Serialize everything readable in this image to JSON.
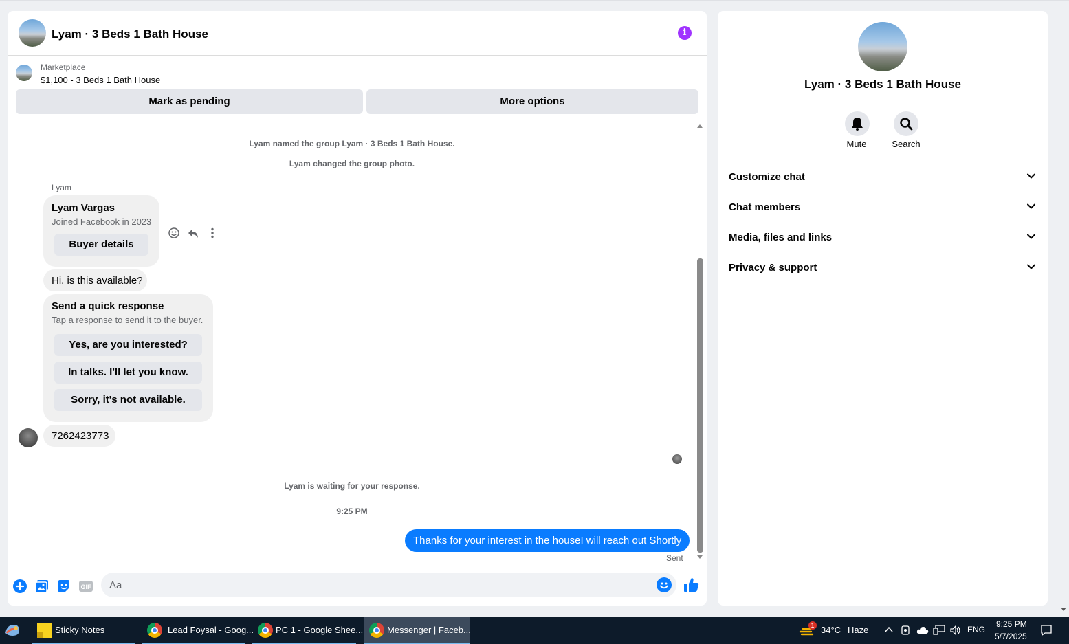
{
  "chat": {
    "title": "Lyam · 3 Beds 1 Bath House",
    "marketplace": {
      "label": "Marketplace",
      "listing": "$1,100 - 3 Beds 1 Bath House"
    },
    "actions": {
      "mark_pending": "Mark as pending",
      "more_options": "More options"
    },
    "system_messages": [
      "Lyam named the group Lyam · 3 Beds 1 Bath House.",
      "Lyam changed the group photo."
    ],
    "sender_name": "Lyam",
    "profile_card": {
      "name": "Lyam Vargas",
      "joined": "Joined Facebook in 2023",
      "button": "Buyer details"
    },
    "message_availability": "Hi, is this available?",
    "quick_response": {
      "title": "Send a quick response",
      "subtitle": "Tap a response to send it to the buyer.",
      "options": [
        "Yes, are you interested?",
        "In talks. I'll let you know.",
        "Sorry, it's not available."
      ]
    },
    "message_phone": "7262423773",
    "waiting_notice": "Lyam is waiting for your response.",
    "timestamp": "9:25 PM",
    "outgoing_message": "Thanks for your interest in the houseI will reach out Shortly",
    "sent_status": "Sent",
    "composer": {
      "placeholder": "Aa"
    }
  },
  "side_panel": {
    "title": "Lyam · 3 Beds 1 Bath House",
    "mute_label": "Mute",
    "search_label": "Search",
    "sections": [
      "Customize chat",
      "Chat members",
      "Media, files and links",
      "Privacy & support"
    ]
  },
  "taskbar": {
    "items": [
      {
        "label": "Sticky Notes",
        "icon": "sticky-notes-icon"
      },
      {
        "label": "Lead Foysal - Goog...",
        "icon": "chrome-icon"
      },
      {
        "label": "PC 1 - Google Shee...",
        "icon": "chrome-icon"
      },
      {
        "label": "Messenger | Faceb...",
        "icon": "chrome-icon"
      }
    ],
    "weather_badge": "1",
    "weather": "34°C",
    "weather_desc": "Haze",
    "language": "ENG",
    "time": "9:25 PM",
    "date": "5/7/2025"
  },
  "colors": {
    "accent": "#0a7cff",
    "info": "#a033ff",
    "bubble_in": "#f0f0f0",
    "taskbar": "#0d1b2a"
  }
}
